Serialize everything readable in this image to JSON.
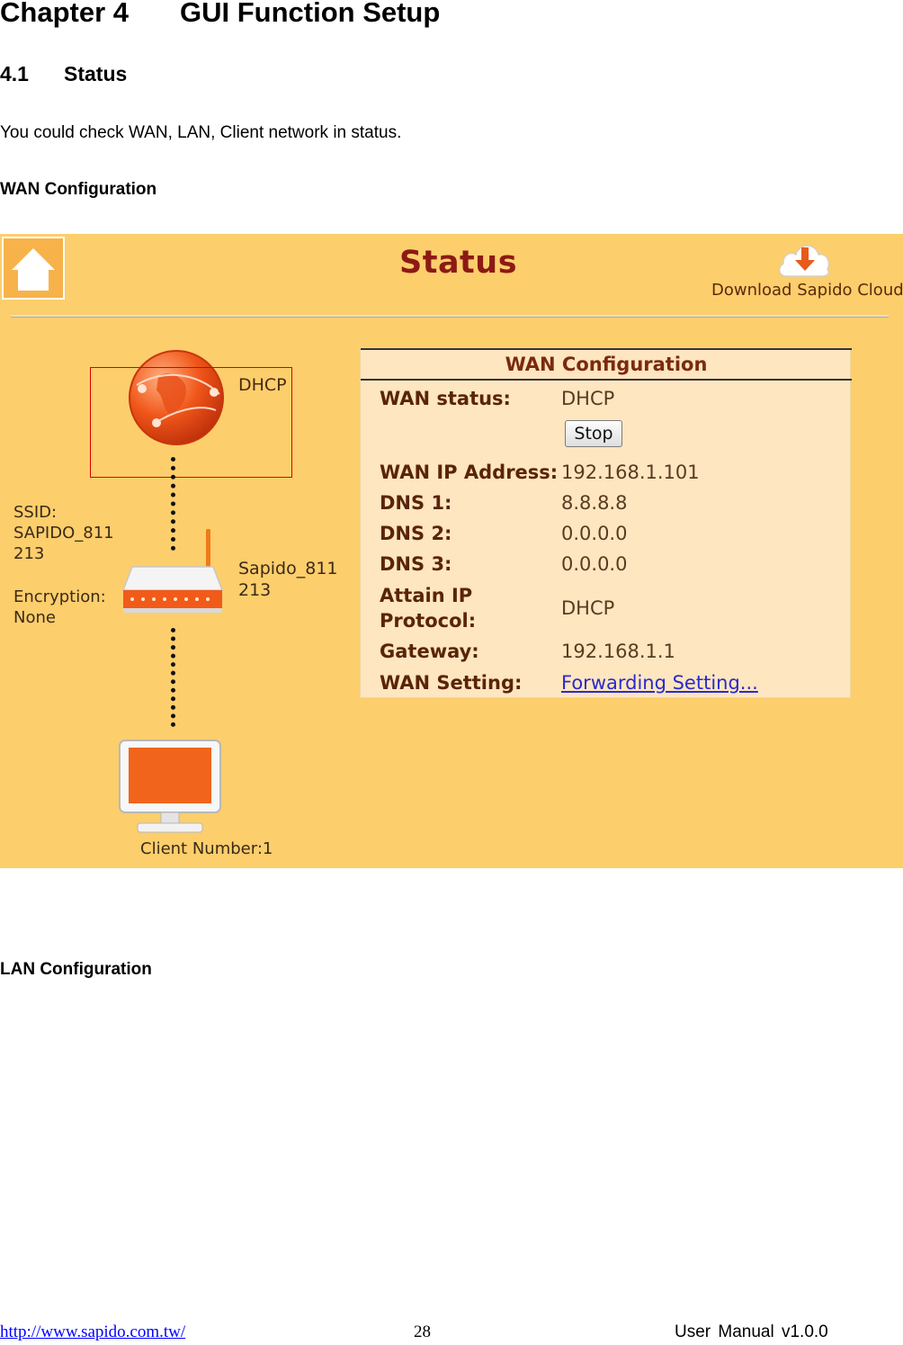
{
  "doc": {
    "chapter_number": "Chapter 4",
    "chapter_title": "GUI Function Setup",
    "section_number": "4.1",
    "section_title": "Status",
    "intro": "You could check WAN, LAN, Client network in status.",
    "wan_heading": "WAN Configuration",
    "lan_heading": "LAN Configuration"
  },
  "screenshot": {
    "title": "Status",
    "download_label": "Download Sapido Cloud",
    "home_icon": "home-icon",
    "download_icon": "cloud-download-icon",
    "internet_label": "DHCP",
    "ssid_label": "SSID:",
    "ssid_value": "SAPIDO_811\n213",
    "encryption_label": "Encryption:",
    "encryption_value": "None",
    "router_name": "Sapido_811 213",
    "client_number": "Client Number:1",
    "wan_panel": {
      "heading": "WAN Configuration",
      "status_label": "WAN status:",
      "status_value": "DHCP",
      "stop_label": "Stop",
      "ip_label": "WAN IP Address:",
      "ip_value": "192.168.1.101",
      "dns1_label": "DNS 1:",
      "dns1_value": "8.8.8.8",
      "dns2_label": "DNS 2:",
      "dns2_value": "0.0.0.0",
      "dns3_label": "DNS 3:",
      "dns3_value": "0.0.0.0",
      "protocol_label": "Attain IP\nProtocol:",
      "protocol_value": "DHCP",
      "gateway_label": "Gateway:",
      "gateway_value": "192.168.1.1",
      "setting_label": "WAN Setting:",
      "setting_link": "Forwarding Setting..."
    },
    "colors": {
      "background": "#fcce6c",
      "panel": "#fde6c0",
      "title": "#8b1a14",
      "highlight": "#e00000"
    }
  },
  "footer": {
    "url": "http://www.sapido.com.tw/",
    "page": "28",
    "version": "User Manual v1.0.0"
  }
}
